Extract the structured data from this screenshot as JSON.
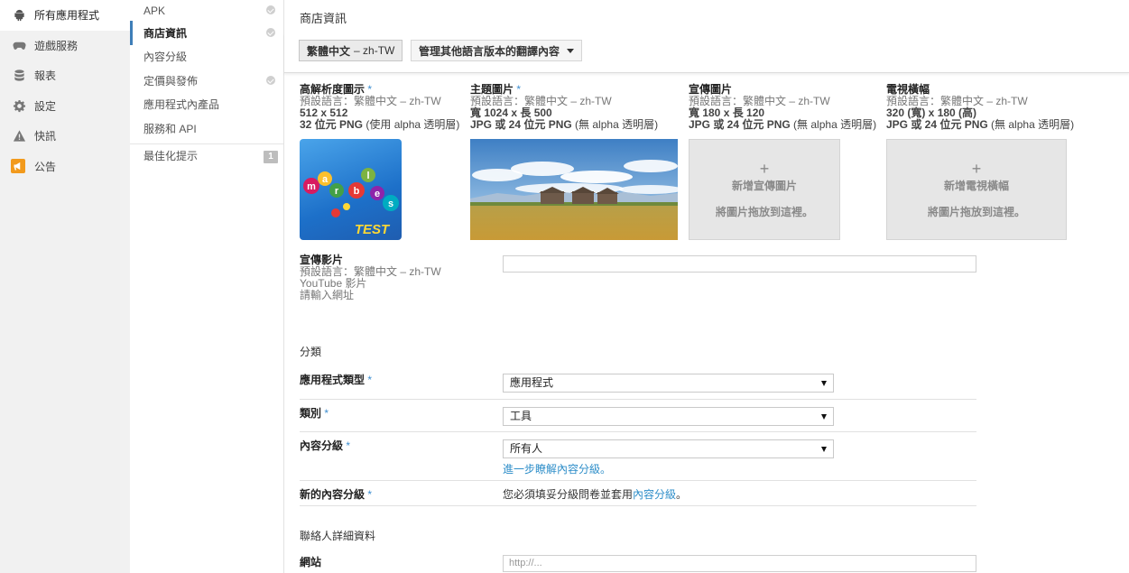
{
  "leftnav": {
    "items": [
      {
        "label": "所有應用程式",
        "icon": "android-icon"
      },
      {
        "label": "遊戲服務",
        "icon": "gamepad-icon"
      },
      {
        "label": "報表",
        "icon": "database-icon"
      },
      {
        "label": "設定",
        "icon": "gear-icon"
      },
      {
        "label": "快訊",
        "icon": "warning-icon"
      },
      {
        "label": "公告",
        "icon": "megaphone-icon"
      }
    ]
  },
  "subnav": {
    "items": [
      {
        "label": "APK"
      },
      {
        "label": "商店資訊"
      },
      {
        "label": "內容分級"
      },
      {
        "label": "定價與發佈"
      },
      {
        "label": "應用程式內產品"
      },
      {
        "label": "服務和 API"
      }
    ],
    "optimize": {
      "label": "最佳化提示",
      "badge": "1"
    }
  },
  "main": {
    "title": "商店資訊",
    "lang_button": {
      "bold": "繁體中文",
      "rest": "– zh-TW"
    },
    "manage_button": "管理其他語言版本的翻譯內容",
    "assets": {
      "icon": {
        "title": "高解析度圖示",
        "req": "*",
        "lang": "預設語言：繁體中文 – zh-TW",
        "size": "512 x 512",
        "format_bold": "32 位元 PNG",
        "format_rest": "(使用 alpha 透明層)"
      },
      "feature": {
        "title": "主題圖片",
        "req": "*",
        "lang": "預設語言：繁體中文 – zh-TW",
        "size": "寬 1024 x 長 500",
        "format_bold": "JPG 或 24 位元 PNG",
        "format_rest": "(無 alpha 透明層)"
      },
      "promo": {
        "title": "宣傳圖片",
        "lang": "預設語言：繁體中文 – zh-TW",
        "size": "寬 180 x 長 120",
        "format_bold": "JPG 或 24 位元 PNG",
        "format_rest": "(無 alpha 透明層)",
        "add": "新增宣傳圖片",
        "drag": "將圖片拖放到這裡。"
      },
      "tv": {
        "title": "電視橫幅",
        "lang": "預設語言：繁體中文 – zh-TW",
        "size": "320 (寬) x 180 (高)",
        "format_bold": "JPG 或 24 位元 PNG",
        "format_rest": "(無 alpha 透明層)",
        "add": "新增電視橫幅",
        "drag": "將圖片拖放到這裡。"
      }
    },
    "icon_letters": "marbles",
    "icon_test": "TEST",
    "video": {
      "title": "宣傳影片",
      "lang": "預設語言：繁體中文 – zh-TW",
      "sub": "YouTube 影片",
      "hint": "請輸入網址",
      "value": ""
    },
    "categorization": {
      "heading": "分類",
      "app_type": {
        "label": "應用程式類型",
        "req": "*",
        "value": "應用程式"
      },
      "category": {
        "label": "類別",
        "req": "*",
        "value": "工具"
      },
      "rating": {
        "label": "內容分級",
        "req": "*",
        "value": "所有人",
        "help": "進一步瞭解內容分級。"
      },
      "new_rating": {
        "label": "新的內容分級",
        "req": "*",
        "note_pre": "您必須填妥分級問卷並套用",
        "note_link": "內容分級",
        "note_post": "。"
      }
    },
    "contact": {
      "heading": "聯絡人詳細資料",
      "website": {
        "label": "網站",
        "placeholder": "http://..."
      }
    }
  },
  "colors": {
    "accent": "#3e7eb8",
    "link": "#2e8ec9",
    "required": "#3e8ed0",
    "announce": "#f29a1c"
  }
}
